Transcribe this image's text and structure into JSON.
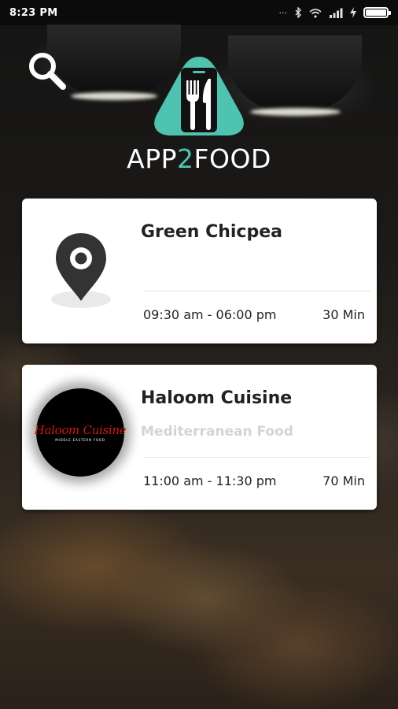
{
  "status_bar": {
    "time": "8:23 PM",
    "icons": [
      "signal-dots-icon",
      "bluetooth-icon",
      "wifi-icon",
      "cellular-icon",
      "charging-icon",
      "battery-icon"
    ],
    "battery_level": 1.0
  },
  "header": {
    "search_icon": "search-icon",
    "logo": {
      "text_prefix": "APP",
      "text_accent": "2",
      "text_suffix": "FOOD",
      "accent_color": "#4ec3b0",
      "mark_icon": "phone-fork-knife-icon"
    }
  },
  "restaurants": [
    {
      "name": "Green Chicpea",
      "cuisine": "",
      "hours": "09:30 am - 06:00 pm",
      "delivery_time": "30 Min",
      "thumb_icon": "map-pin-icon"
    },
    {
      "name": "Haloom Cuisine",
      "cuisine": "Mediterranean Food",
      "hours": "11:00 am - 11:30 pm",
      "delivery_time": "70 Min",
      "logo_text": "Haloom Cuisine",
      "logo_subtext": "MIDDLE EASTERN FOOD"
    }
  ],
  "colors": {
    "brand_teal": "#4ec3b0",
    "card_background": "#ffffff",
    "cuisine_text": "#d4d4d4",
    "haloom_red": "#d11919"
  }
}
